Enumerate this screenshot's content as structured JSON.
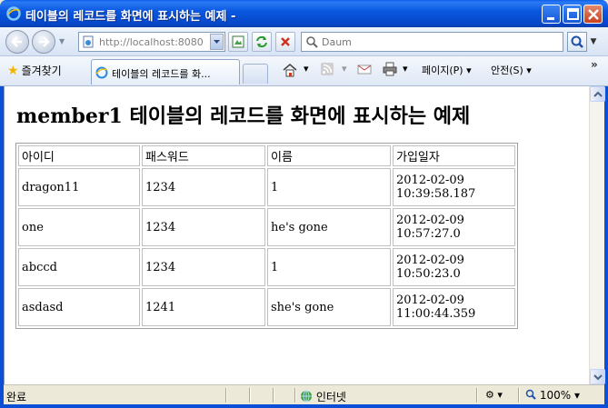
{
  "window": {
    "title": "테이블의 레코드를 화면에 표시하는 예제 -"
  },
  "navigation": {
    "address": "http://localhost:8080",
    "search_placeholder": "Daum"
  },
  "commandbar": {
    "favorites_label": "즐겨찾기",
    "tab_label": "테이블의 레코드를 화...",
    "page_menu": "페이지(P)",
    "safety_menu": "안전(S)"
  },
  "page": {
    "heading": "member1 테이블의 레코드를 화면에 표시하는 예제",
    "table": {
      "headers": [
        "아이디",
        "패스워드",
        "이름",
        "가입일자"
      ],
      "rows": [
        [
          "dragon11",
          "1234",
          "1",
          "2012-02-09 10:39:58.187"
        ],
        [
          "one",
          "1234",
          "he's gone",
          "2012-02-09 10:57:27.0"
        ],
        [
          "abccd",
          "1234",
          "1",
          "2012-02-09 10:50:23.0"
        ],
        [
          "asdasd",
          "1241",
          "she's gone",
          "2012-02-09 11:00:44.359"
        ]
      ]
    }
  },
  "status": {
    "text": "완료",
    "zone": "인터넷",
    "zoom": "100%"
  },
  "colors": {
    "titlebar": "#0a58e0",
    "close_button": "#c8401e",
    "content_bg": "#ffffff"
  },
  "icons": [
    "ie-icon",
    "minimize-icon",
    "maximize-icon",
    "close-icon",
    "back-arrow-icon",
    "forward-arrow-icon",
    "page-icon",
    "compat-view-icon",
    "refresh-icon",
    "stop-icon",
    "search-icon",
    "star-icon",
    "home-icon",
    "rss-icon",
    "mail-icon",
    "print-icon",
    "globe-icon",
    "zoom-icon"
  ]
}
